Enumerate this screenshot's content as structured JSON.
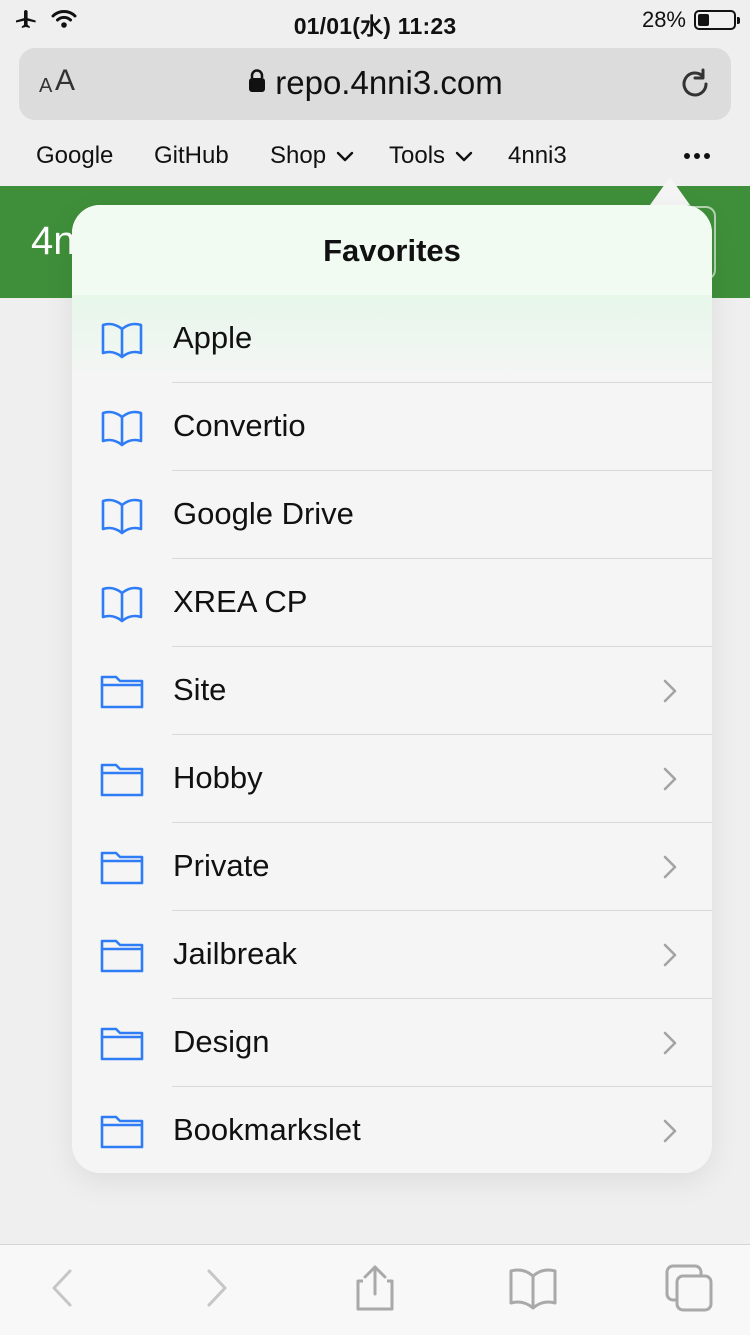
{
  "status_bar": {
    "time": "01/01(水) 11:23",
    "battery": "28%"
  },
  "url_bar": {
    "text_size_label_small": "A",
    "text_size_label_large": "A",
    "url": "repo.4nni3.com"
  },
  "favorites_bar": {
    "items": [
      {
        "label": "Google"
      },
      {
        "label": "GitHub"
      },
      {
        "label": "Shop"
      },
      {
        "label": "Tools"
      },
      {
        "label": "4nni3"
      }
    ]
  },
  "page": {
    "title_fragment": "4n"
  },
  "popover": {
    "title": "Favorites",
    "items": [
      {
        "label": "Apple",
        "icon": "book-icon"
      },
      {
        "label": "Convertio",
        "icon": "book-icon"
      },
      {
        "label": "Google Drive",
        "icon": "book-icon"
      },
      {
        "label": "XREA CP",
        "icon": "book-icon"
      },
      {
        "label": "Site",
        "icon": "folder-icon"
      },
      {
        "label": "Hobby",
        "icon": "folder-icon"
      },
      {
        "label": "Private",
        "icon": "folder-icon"
      },
      {
        "label": "Jailbreak",
        "icon": "folder-icon"
      },
      {
        "label": "Design",
        "icon": "folder-icon"
      },
      {
        "label": "Bookmarkslet",
        "icon": "folder-icon"
      }
    ]
  },
  "colors": {
    "accent": "#2f7df6",
    "page_band": "#3f8f3a"
  }
}
